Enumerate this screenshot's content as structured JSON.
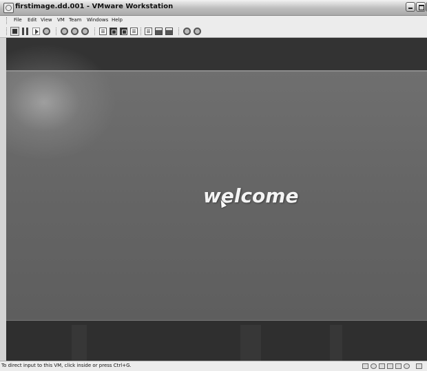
{
  "window": {
    "title": "firstimage.dd.001 - VMware Workstation"
  },
  "menu": {
    "items": [
      "File",
      "Edit",
      "View",
      "VM",
      "Team",
      "Windows",
      "Help"
    ]
  },
  "toolbar": {
    "icons": [
      "stop-icon",
      "pause-icon",
      "play-icon",
      "reset-icon",
      "snapshot-icon",
      "revert-snapshot-icon",
      "snapshot-manager-icon",
      "sidebar-icon",
      "full-screen-icon",
      "quick-switch-icon",
      "console-view-icon",
      "summary-icon",
      "appliance-view-icon",
      "console-icon",
      "team-icon",
      "network-icon"
    ]
  },
  "vm": {
    "welcome_text": "welcome"
  },
  "status": {
    "text": "To direct input to this VM, click inside or press Ctrl+G."
  },
  "colors": {
    "vm_background": "#666666",
    "vm_band": "#333333",
    "welcome_text": "#f4f4f4"
  }
}
